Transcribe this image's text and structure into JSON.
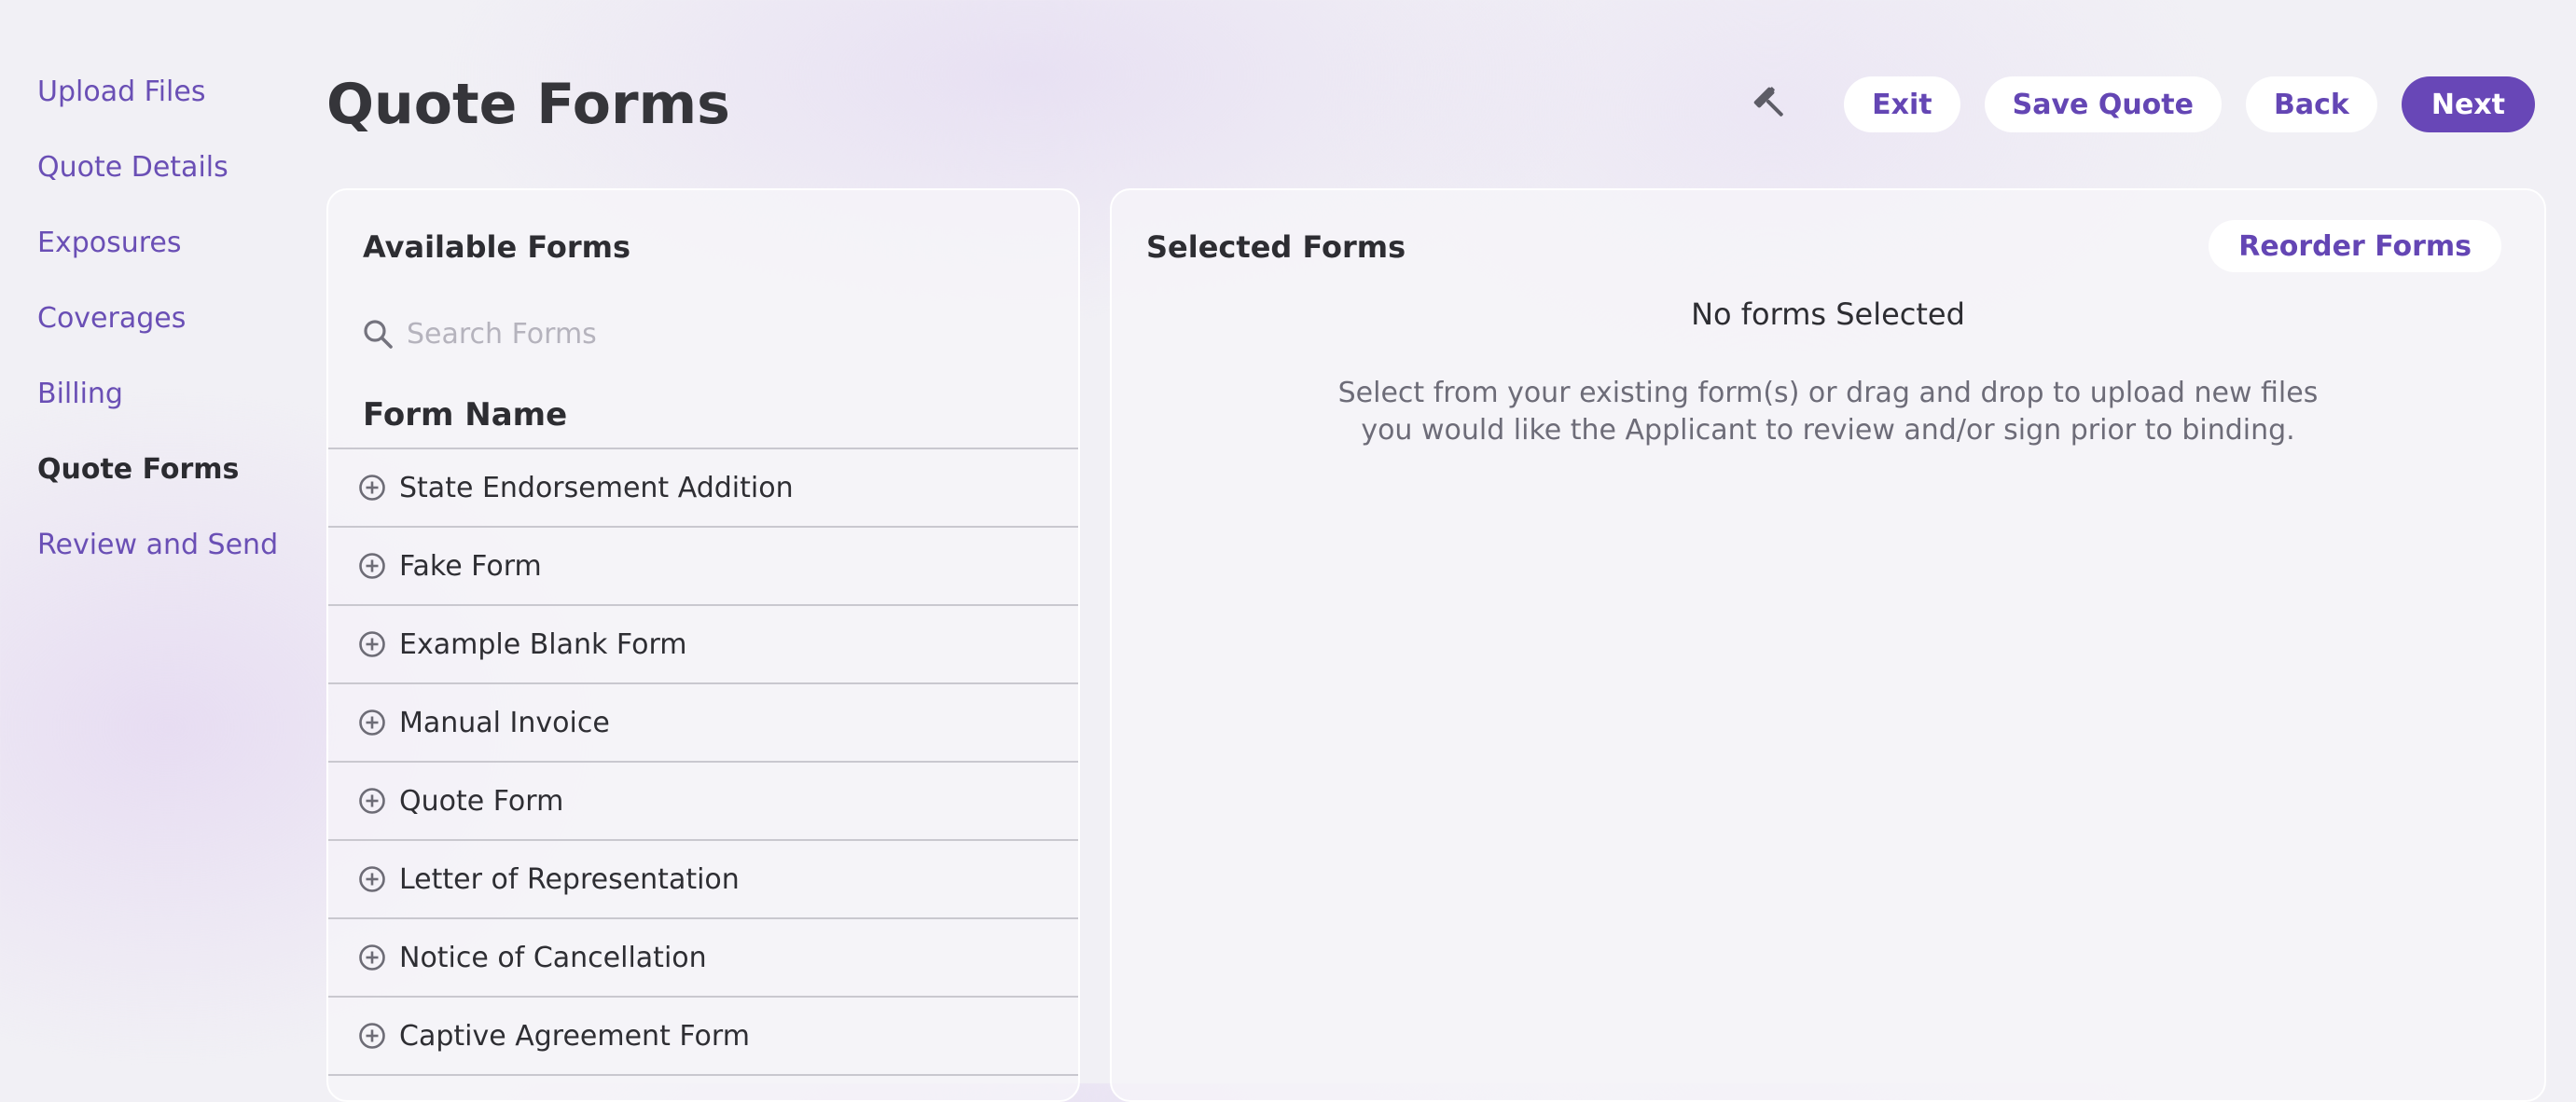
{
  "sidebar": {
    "items": [
      {
        "label": "Upload Files"
      },
      {
        "label": "Quote Details"
      },
      {
        "label": "Exposures"
      },
      {
        "label": "Coverages"
      },
      {
        "label": "Billing"
      },
      {
        "label": "Quote Forms",
        "active": true
      },
      {
        "label": "Review and Send"
      }
    ]
  },
  "header": {
    "title": "Quote Forms",
    "tool_icon": "hammer-icon",
    "buttons": {
      "exit": "Exit",
      "save_quote": "Save Quote",
      "back": "Back",
      "next": "Next"
    }
  },
  "available_forms": {
    "heading": "Available Forms",
    "search_placeholder": "Search Forms",
    "search_value": "",
    "column_header": "Form Name",
    "add_icon": "plus-circle-icon",
    "forms": [
      {
        "name": "State Endorsement Addition"
      },
      {
        "name": "Fake Form"
      },
      {
        "name": "Example Blank Form"
      },
      {
        "name": "Manual Invoice"
      },
      {
        "name": "Quote Form"
      },
      {
        "name": "Letter of Representation"
      },
      {
        "name": "Notice of Cancellation"
      },
      {
        "name": "Captive Agreement Form"
      }
    ]
  },
  "selected_forms": {
    "heading": "Selected Forms",
    "reorder_label": "Reorder Forms",
    "empty_title": "No forms Selected",
    "empty_description": "Select from your existing form(s) or drag and drop to upload new files you would like the Applicant to review and/or sign prior to binding."
  },
  "colors": {
    "accent": "#6847b7",
    "link": "#6a4fb5",
    "background": "#f1f0f5"
  }
}
